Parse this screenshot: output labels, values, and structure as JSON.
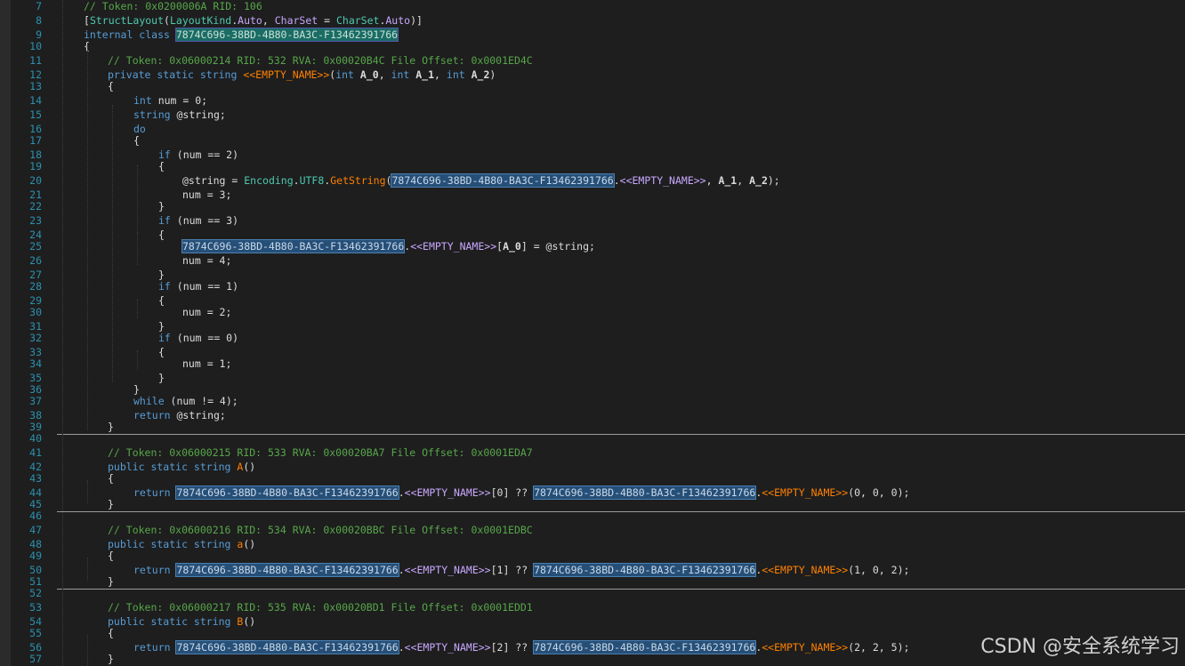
{
  "lines": [
    {
      "n": "7",
      "indent": 1,
      "parts": [
        [
          "cm",
          "// Token: 0x0200006A RID: 106"
        ]
      ]
    },
    {
      "n": "8",
      "indent": 1,
      "parts": [
        [
          "pl",
          "["
        ],
        [
          "ty",
          "StructLayout"
        ],
        [
          "pl",
          "("
        ],
        [
          "ty",
          "LayoutKind"
        ],
        [
          "pl",
          "."
        ],
        [
          "mem",
          "Auto"
        ],
        [
          "pl",
          ", "
        ],
        [
          "mem",
          "CharSet"
        ],
        [
          "pl",
          " = "
        ],
        [
          "ty",
          "CharSet"
        ],
        [
          "pl",
          "."
        ],
        [
          "mem",
          "Auto"
        ],
        [
          "pl",
          ")]"
        ]
      ]
    },
    {
      "n": "9",
      "indent": 1,
      "parts": [
        [
          "kw",
          "internal class "
        ],
        [
          "hl-sel",
          "7874C696-38BD-4B80-BA3C-F13462391766"
        ]
      ]
    },
    {
      "n": "10",
      "indent": 1,
      "parts": [
        [
          "pl",
          "{"
        ]
      ]
    },
    {
      "n": "11",
      "indent": 2,
      "parts": [
        [
          "cm",
          "// Token: 0x06000214 RID: 532 RVA: 0x00020B4C File Offset: 0x0001ED4C"
        ]
      ]
    },
    {
      "n": "12",
      "indent": 2,
      "parts": [
        [
          "kw",
          "private static string "
        ],
        [
          "fn",
          "<<EMPTY_NAME>>"
        ],
        [
          "pl",
          "("
        ],
        [
          "kw",
          "int "
        ],
        [
          "bd",
          "A_0"
        ],
        [
          "pl",
          ", "
        ],
        [
          "kw",
          "int "
        ],
        [
          "bd",
          "A_1"
        ],
        [
          "pl",
          ", "
        ],
        [
          "kw",
          "int "
        ],
        [
          "bd",
          "A_2"
        ],
        [
          "pl",
          ")"
        ]
      ]
    },
    {
      "n": "13",
      "indent": 2,
      "parts": [
        [
          "pl",
          "{"
        ]
      ]
    },
    {
      "n": "14",
      "indent": 3,
      "parts": [
        [
          "kw",
          "int "
        ],
        [
          "pl",
          "num = 0;"
        ]
      ]
    },
    {
      "n": "15",
      "indent": 3,
      "parts": [
        [
          "kw",
          "string "
        ],
        [
          "pl",
          "@string;"
        ]
      ]
    },
    {
      "n": "16",
      "indent": 3,
      "parts": [
        [
          "kw",
          "do"
        ]
      ]
    },
    {
      "n": "17",
      "indent": 3,
      "parts": [
        [
          "pl",
          "{"
        ]
      ]
    },
    {
      "n": "18",
      "indent": 4,
      "parts": [
        [
          "kw",
          "if "
        ],
        [
          "pl",
          "(num == 2)"
        ]
      ]
    },
    {
      "n": "19",
      "indent": 4,
      "parts": [
        [
          "pl",
          "{"
        ]
      ]
    },
    {
      "n": "20",
      "indent": 5,
      "parts": [
        [
          "pl",
          "@string = "
        ],
        [
          "ty",
          "Encoding"
        ],
        [
          "pl",
          "."
        ],
        [
          "ty",
          "UTF8"
        ],
        [
          "pl",
          "."
        ],
        [
          "fn",
          "GetString"
        ],
        [
          "pl",
          "("
        ],
        [
          "hl",
          "7874C696-38BD-4B80-BA3C-F13462391766"
        ],
        [
          "pl",
          "."
        ],
        [
          "mem",
          "<<EMPTY_NAME>>"
        ],
        [
          "pl",
          ", "
        ],
        [
          "bd",
          "A_1"
        ],
        [
          "pl",
          ", "
        ],
        [
          "bd",
          "A_2"
        ],
        [
          "pl",
          ");"
        ]
      ]
    },
    {
      "n": "21",
      "indent": 5,
      "parts": [
        [
          "pl",
          "num = 3;"
        ]
      ]
    },
    {
      "n": "22",
      "indent": 4,
      "parts": [
        [
          "pl",
          "}"
        ]
      ]
    },
    {
      "n": "23",
      "indent": 4,
      "parts": [
        [
          "kw",
          "if "
        ],
        [
          "pl",
          "(num == 3)"
        ]
      ]
    },
    {
      "n": "24",
      "indent": 4,
      "parts": [
        [
          "pl",
          "{"
        ]
      ]
    },
    {
      "n": "25",
      "indent": 5,
      "parts": [
        [
          "hl",
          "7874C696-38BD-4B80-BA3C-F13462391766"
        ],
        [
          "pl",
          "."
        ],
        [
          "mem",
          "<<EMPTY_NAME>>"
        ],
        [
          "pl",
          "["
        ],
        [
          "bd",
          "A_0"
        ],
        [
          "pl",
          "] = @string;"
        ]
      ]
    },
    {
      "n": "26",
      "indent": 5,
      "parts": [
        [
          "pl",
          "num = 4;"
        ]
      ]
    },
    {
      "n": "27",
      "indent": 4,
      "parts": [
        [
          "pl",
          "}"
        ]
      ]
    },
    {
      "n": "28",
      "indent": 4,
      "parts": [
        [
          "kw",
          "if "
        ],
        [
          "pl",
          "(num == 1)"
        ]
      ]
    },
    {
      "n": "29",
      "indent": 4,
      "parts": [
        [
          "pl",
          "{"
        ]
      ]
    },
    {
      "n": "30",
      "indent": 5,
      "parts": [
        [
          "pl",
          "num = 2;"
        ]
      ]
    },
    {
      "n": "31",
      "indent": 4,
      "parts": [
        [
          "pl",
          "}"
        ]
      ]
    },
    {
      "n": "32",
      "indent": 4,
      "parts": [
        [
          "kw",
          "if "
        ],
        [
          "pl",
          "(num == 0)"
        ]
      ]
    },
    {
      "n": "33",
      "indent": 4,
      "parts": [
        [
          "pl",
          "{"
        ]
      ]
    },
    {
      "n": "34",
      "indent": 5,
      "parts": [
        [
          "pl",
          "num = 1;"
        ]
      ]
    },
    {
      "n": "35",
      "indent": 4,
      "parts": [
        [
          "pl",
          "}"
        ]
      ]
    },
    {
      "n": "36",
      "indent": 3,
      "parts": [
        [
          "pl",
          "}"
        ]
      ]
    },
    {
      "n": "37",
      "indent": 3,
      "parts": [
        [
          "kw",
          "while "
        ],
        [
          "pl",
          "(num != 4);"
        ]
      ]
    },
    {
      "n": "38",
      "indent": 3,
      "parts": [
        [
          "kw",
          "return "
        ],
        [
          "pl",
          "@string;"
        ]
      ]
    },
    {
      "n": "39",
      "indent": 2,
      "parts": [
        [
          "pl",
          "}"
        ]
      ],
      "sep": true
    },
    {
      "n": "40",
      "indent": 0,
      "parts": []
    },
    {
      "n": "41",
      "indent": 2,
      "parts": [
        [
          "cm",
          "// Token: 0x06000215 RID: 533 RVA: 0x00020BA7 File Offset: 0x0001EDA7"
        ]
      ]
    },
    {
      "n": "42",
      "indent": 2,
      "parts": [
        [
          "kw",
          "public static string "
        ],
        [
          "fn",
          "A"
        ],
        [
          "pl",
          "()"
        ]
      ]
    },
    {
      "n": "43",
      "indent": 2,
      "parts": [
        [
          "pl",
          "{"
        ]
      ]
    },
    {
      "n": "44",
      "indent": 3,
      "parts": [
        [
          "kw",
          "return "
        ],
        [
          "hl",
          "7874C696-38BD-4B80-BA3C-F13462391766"
        ],
        [
          "pl",
          "."
        ],
        [
          "mem",
          "<<EMPTY_NAME>>"
        ],
        [
          "pl",
          "[0] ?? "
        ],
        [
          "hl",
          "7874C696-38BD-4B80-BA3C-F13462391766"
        ],
        [
          "pl",
          "."
        ],
        [
          "fn",
          "<<EMPTY_NAME>>"
        ],
        [
          "pl",
          "(0, 0, 0);"
        ]
      ]
    },
    {
      "n": "45",
      "indent": 2,
      "parts": [
        [
          "pl",
          "}"
        ]
      ],
      "sep": true
    },
    {
      "n": "46",
      "indent": 0,
      "parts": []
    },
    {
      "n": "47",
      "indent": 2,
      "parts": [
        [
          "cm",
          "// Token: 0x06000216 RID: 534 RVA: 0x00020BBC File Offset: 0x0001EDBC"
        ]
      ]
    },
    {
      "n": "48",
      "indent": 2,
      "parts": [
        [
          "kw",
          "public static string "
        ],
        [
          "fn",
          "a"
        ],
        [
          "pl",
          "()"
        ]
      ]
    },
    {
      "n": "49",
      "indent": 2,
      "parts": [
        [
          "pl",
          "{"
        ]
      ]
    },
    {
      "n": "50",
      "indent": 3,
      "parts": [
        [
          "kw",
          "return "
        ],
        [
          "hl",
          "7874C696-38BD-4B80-BA3C-F13462391766"
        ],
        [
          "pl",
          "."
        ],
        [
          "mem",
          "<<EMPTY_NAME>>"
        ],
        [
          "pl",
          "[1] ?? "
        ],
        [
          "hl",
          "7874C696-38BD-4B80-BA3C-F13462391766"
        ],
        [
          "pl",
          "."
        ],
        [
          "fn",
          "<<EMPTY_NAME>>"
        ],
        [
          "pl",
          "(1, 0, 2);"
        ]
      ]
    },
    {
      "n": "51",
      "indent": 2,
      "parts": [
        [
          "pl",
          "}"
        ]
      ],
      "sep": true
    },
    {
      "n": "52",
      "indent": 0,
      "parts": []
    },
    {
      "n": "53",
      "indent": 2,
      "parts": [
        [
          "cm",
          "// Token: 0x06000217 RID: 535 RVA: 0x00020BD1 File Offset: 0x0001EDD1"
        ]
      ]
    },
    {
      "n": "54",
      "indent": 2,
      "parts": [
        [
          "kw",
          "public static string "
        ],
        [
          "fn",
          "B"
        ],
        [
          "pl",
          "()"
        ]
      ]
    },
    {
      "n": "55",
      "indent": 2,
      "parts": [
        [
          "pl",
          "{"
        ]
      ]
    },
    {
      "n": "56",
      "indent": 3,
      "parts": [
        [
          "kw",
          "return "
        ],
        [
          "hl",
          "7874C696-38BD-4B80-BA3C-F13462391766"
        ],
        [
          "pl",
          "."
        ],
        [
          "mem",
          "<<EMPTY_NAME>>"
        ],
        [
          "pl",
          "[2] ?? "
        ],
        [
          "hl",
          "7874C696-38BD-4B80-BA3C-F13462391766"
        ],
        [
          "pl",
          "."
        ],
        [
          "fn",
          "<<EMPTY_NAME>>"
        ],
        [
          "pl",
          "(2, 2, 5);"
        ]
      ]
    },
    {
      "n": "57",
      "indent": 2,
      "parts": [
        [
          "pl",
          "}"
        ]
      ]
    }
  ],
  "watermark": "CSDN @安全系统学习"
}
